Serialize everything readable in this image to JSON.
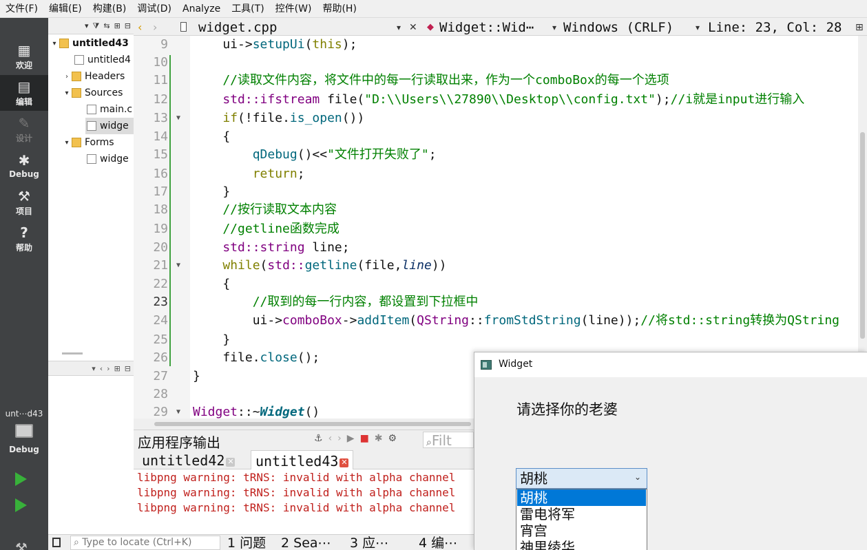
{
  "menu": [
    "文件(F)",
    "编辑(E)",
    "构建(B)",
    "调试(D)",
    "Analyze",
    "工具(T)",
    "控件(W)",
    "帮助(H)"
  ],
  "modes": [
    {
      "label": "欢迎",
      "icon": "grid-icon"
    },
    {
      "label": "编辑",
      "icon": "edit-icon"
    },
    {
      "label": "设计",
      "icon": "pencil-icon"
    },
    {
      "label": "Debug",
      "icon": "bug-icon"
    },
    {
      "label": "项目",
      "icon": "wrench-icon"
    },
    {
      "label": "帮助",
      "icon": "help-icon"
    }
  ],
  "kit": {
    "project": "unt⋯d43",
    "config": "Debug"
  },
  "tree": {
    "root": "untitled43",
    "pro_file": "untitled4",
    "headers": "Headers",
    "sources": "Sources",
    "main_cpp": "main.c",
    "widget_cpp": "widge",
    "forms": "Forms",
    "widget_ui": "widge"
  },
  "editor": {
    "file_tab": "widget.cpp",
    "symbol": "Widget::Wid⋯",
    "encoding": "Windows (CRLF)",
    "cursor": "Line: 23, Col: 28"
  },
  "code": {
    "line_numbers": [
      "9",
      "10",
      "11",
      "12",
      "13",
      "14",
      "15",
      "16",
      "17",
      "18",
      "19",
      "20",
      "21",
      "22",
      "23",
      "24",
      "25",
      "26",
      "27",
      "28",
      "29"
    ],
    "current_line": "23",
    "l9": {
      "a": "    ui->",
      "b": "setupUi",
      "c": "(",
      "d": "this",
      "e": ");"
    },
    "l11": "    //读取文件内容，将文件中的每一行读取出来，作为一个comboBox的每一个选项",
    "l12": {
      "a": "    ",
      "b": "std::ifstream",
      "c": " file(",
      "d": "\"D:\\\\Users\\\\27890\\\\Desktop\\\\config.txt\"",
      "e": ");",
      "f": "//i就是input进行输入"
    },
    "l13": {
      "a": "    ",
      "b": "if",
      "c": "(!file.",
      "d": "is_open",
      "e": "())"
    },
    "l14": "    {",
    "l15": {
      "a": "        ",
      "b": "qDebug",
      "c": "()<<",
      "d": "\"文件打开失败了\"",
      "e": ";"
    },
    "l16": {
      "a": "        ",
      "b": "return",
      "c": ";"
    },
    "l17": "    }",
    "l18": "    //按行读取文本内容",
    "l19": "    //getline函数完成",
    "l20": {
      "a": "    ",
      "b": "std::string",
      "c": " line;"
    },
    "l21": {
      "a": "    ",
      "b": "while",
      "c": "(",
      "d": "std::",
      "e": "getline",
      "f": "(file,",
      "g": "line",
      "h": "))"
    },
    "l22": "    {",
    "l23": "        //取到的每一行内容，都设置到下拉框中",
    "l24": {
      "a": "        ui->",
      "b": "comboBox",
      "c": "->",
      "d": "addItem",
      "e": "(",
      "f": "QString",
      "g": "::",
      "h": "fromStdString",
      "i": "(line));",
      "j": "//将std::string转换为QString"
    },
    "l25": "    }",
    "l26": {
      "a": "    file.",
      "b": "close",
      "c": "();"
    },
    "l27": "}",
    "l29": {
      "a": "Widget",
      "b": "::~",
      "c": "Widget",
      "d": "()"
    }
  },
  "output": {
    "title": "应用程序输出",
    "filter_placeholder": "Filt",
    "tabs": [
      "untitled42",
      "untitled43"
    ],
    "lines": [
      "libpng warning: tRNS: invalid with alpha channel",
      "libpng warning: tRNS: invalid with alpha channel",
      "libpng warning: tRNS: invalid with alpha channel"
    ]
  },
  "status": {
    "locator_placeholder": "Type to locate (Ctrl+K)",
    "panes": [
      "1 问题",
      "2 Sea⋯",
      "3 应⋯",
      "4 编⋯"
    ]
  },
  "widget_window": {
    "title": "Widget",
    "prompt": "请选择你的老婆",
    "combo_value": "胡桃",
    "options": [
      "胡桃",
      "雷电将军",
      "宵宫",
      "神里绫华"
    ]
  }
}
